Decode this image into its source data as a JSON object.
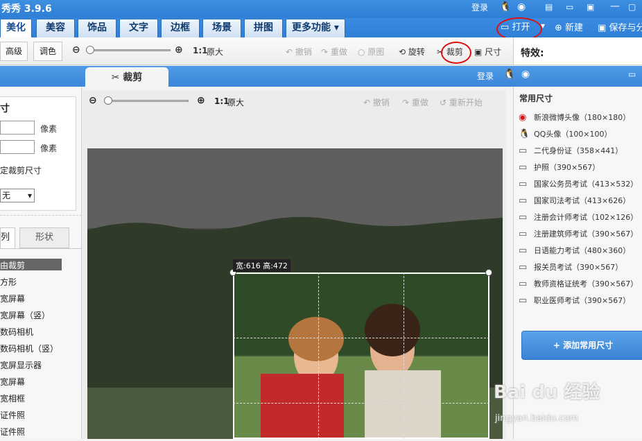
{
  "window": {
    "title": "秀秀 3.9.6",
    "login": "登录"
  },
  "tabs": [
    "美化",
    "美容",
    "饰品",
    "文字",
    "边框",
    "场景",
    "拼图",
    "更多功能"
  ],
  "header_actions": {
    "open": "打开",
    "new": "新建",
    "save": "保存与分"
  },
  "toolbar": {
    "advanced": "高级",
    "tone": "调色",
    "ratio": "1:1",
    "original_size": "原大",
    "undo": "撤销",
    "redo": "重做",
    "original": "原图",
    "rotate": "旋转",
    "crop": "裁剪",
    "size": "尺寸"
  },
  "effects_label": "特效:",
  "crop_tab": {
    "label": "裁剪",
    "login": "登录"
  },
  "left_panel": {
    "title_fragment": "寸",
    "unit_width": "像素",
    "unit_height": "像素",
    "fixed_size_label": "定裁剪尺寸",
    "select_value": "无",
    "tab_ratio": "列",
    "tab_shape": "形状",
    "items": [
      "由裁剪",
      "方形",
      "宽屏幕",
      "宽屏幕（竖）",
      "数码相机",
      "数码相机（竖）",
      "宽屏显示器",
      "宽屏幕",
      "宽相框",
      "证件照",
      "证件照"
    ]
  },
  "center": {
    "ratio": "1:1",
    "original_size": "原大",
    "undo": "撤销",
    "redo": "重做",
    "restart": "重新开始",
    "crop_info": "宽:616 高:472"
  },
  "right_panel": {
    "title": "常用尺寸",
    "items": [
      "新浪微博头像（180×180）",
      "QQ头像（100×100）",
      "二代身份证（358×441）",
      "护照（390×567）",
      "国家公务员考试（413×532）",
      "国家司法考试（413×626）",
      "注册会计师考试（102×126）",
      "注册建筑师考试（390×567）",
      "日语能力考试（480×360）",
      "报关员考试（390×567）",
      "教师资格证统考（390×567）",
      "职业医师考试（390×567）"
    ],
    "add_button": "添加常用尺寸"
  },
  "watermark": {
    "brand": "Bai du 经验",
    "url": "jingyan.baidu.com"
  },
  "colors": {
    "accent": "#2f7fd8",
    "highlight": "#d11111"
  }
}
